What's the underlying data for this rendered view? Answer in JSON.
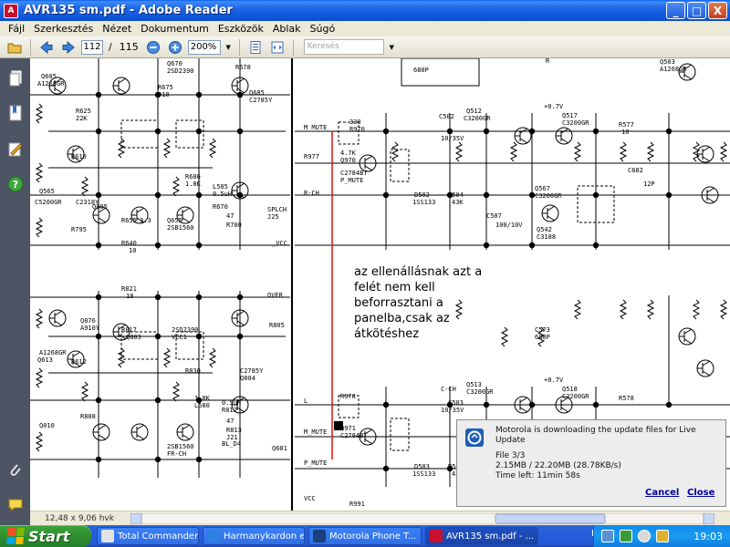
{
  "window": {
    "title": "AVR135 sm.pdf - Adobe Reader",
    "minimize_label": "_",
    "maximize_label": "□",
    "close_label": "X"
  },
  "menu": {
    "items": [
      {
        "label": "Fájl"
      },
      {
        "label": "Szerkesztés"
      },
      {
        "label": "Nézet"
      },
      {
        "label": "Dokumentum"
      },
      {
        "label": "Eszközök"
      },
      {
        "label": "Ablak"
      },
      {
        "label": "Súgó"
      }
    ]
  },
  "toolbar": {
    "current_page": "112",
    "page_separator": "/",
    "total_pages": "115",
    "zoom": "200%",
    "search_placeholder": "Keresés"
  },
  "document": {
    "annotation_text": "az ellenállásnak azt a felét nem kell beforrasztani a panelba,csak az átkötéshez",
    "schematic_labels": [
      "Q605",
      "A1268GR",
      "Q670",
      "2SD2390",
      "R678",
      "Q685",
      "C2785Y",
      "R675",
      "910",
      "R625",
      "22K",
      "R610",
      "Q565",
      "C5200GR",
      "C2318Y",
      "Q005",
      "R795",
      "R655",
      "3.3",
      "Q655",
      "2SB1560",
      "R686",
      "1.8K",
      "L585",
      "0.5uH",
      "R670",
      "47",
      "R700",
      "SPLCH",
      "J25",
      "_VCC",
      "R640",
      "10",
      "R821",
      "18",
      "Q876",
      "A910Y",
      "R817",
      "Q803",
      "2SD2390",
      "VCC1",
      "OVER",
      "R805",
      "R830",
      "R612",
      "A1268GR",
      "Q613",
      "Q010",
      "R808",
      "1.8K",
      "L580",
      "0.5uH",
      "R812",
      "47",
      "R813",
      "J21",
      "BL_D4",
      "Q601",
      "C2785Y",
      "Q804",
      "2SB1560",
      "FR-CH",
      "680P",
      "R",
      "M_MUTE",
      "R977",
      "330",
      "R970",
      "4.7K",
      "Q970",
      "C2784BT",
      "P_MUTE",
      "R-CH",
      "C502",
      "10/35V",
      "Q512",
      "C3200GR",
      "+0.7V",
      "Q517",
      "C3200GR",
      "D502",
      "1SS133",
      "R504",
      "43K",
      "C507",
      "100/10V",
      "Q567",
      "C3200GR",
      "Q542",
      "C3188",
      "R577",
      "10",
      "C682",
      "12P",
      "Q503",
      "A1268GR",
      "L",
      "M_MUTE",
      "R978",
      "Q971",
      "C2784BT",
      "C-CH",
      "C503",
      "10/35V",
      "Q513",
      "C3200GR",
      "+0.7V",
      "Q518",
      "C3200GR",
      "D503",
      "1SS133",
      "R505",
      "43K",
      "C573",
      "680P",
      "R578",
      "P_MUTE",
      "VCC",
      "R991"
    ]
  },
  "status": {
    "page_dimensions": "12,48 x 9,06 hvk"
  },
  "notification": {
    "title": "Motorola is downloading the update files for Live Update",
    "file_line": "File 3/3",
    "size_line": "2.15MB / 22.20MB (28.78KB/s)",
    "time_line": "Time left: 11min 58s",
    "cancel_label": "Cancel",
    "close_label": "Close"
  },
  "taskbar": {
    "start_label": "Start",
    "tasks": [
      {
        "label": "Total Commander..."
      },
      {
        "label": "Harmanykardon e..."
      },
      {
        "label": "Motorola Phone T..."
      },
      {
        "label": "AVR135 sm.pdf - ..."
      }
    ],
    "language": "HU",
    "clock": "19:03"
  },
  "colors": {
    "titlebar_blue": "#0B55D9",
    "taskbar_blue": "#245DDB",
    "start_green": "#2E8B2E",
    "nav_panel": "#4D5564",
    "link_blue": "#0000A0",
    "annotation_line": "#E01010"
  }
}
